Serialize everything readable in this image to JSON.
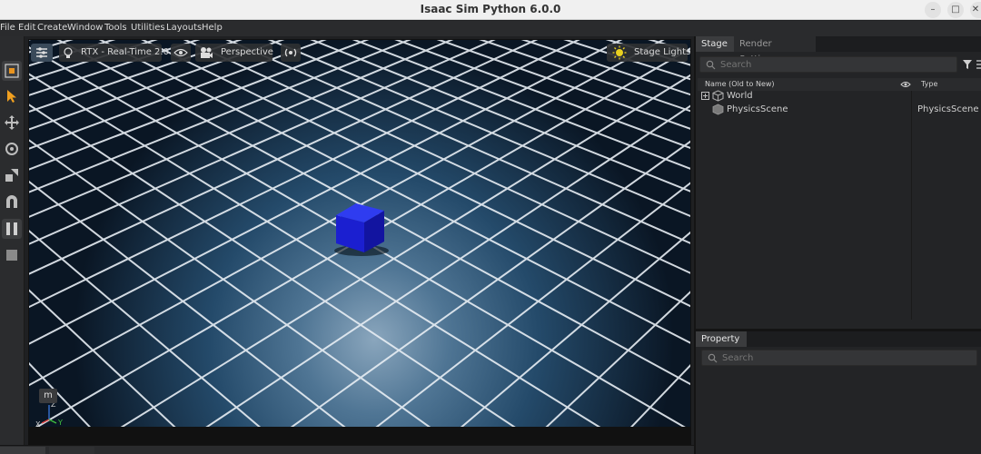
{
  "window": {
    "title": "Isaac Sim Python 6.0.0",
    "minimize_icon": "minimize-icon",
    "maximize_icon": "maximize-icon",
    "close_icon": "close-icon"
  },
  "menubar": {
    "items": [
      {
        "label": "File"
      },
      {
        "label": "Edit"
      },
      {
        "label": "Create"
      },
      {
        "label": "Window"
      },
      {
        "label": "Tools"
      },
      {
        "label": "Utilities"
      },
      {
        "label": "Layouts"
      },
      {
        "label": "Help"
      }
    ]
  },
  "left_toolbar": {
    "tools": [
      {
        "name": "select-mode-icon"
      },
      {
        "name": "select-arrow-icon"
      },
      {
        "name": "move-icon"
      },
      {
        "name": "rotate-icon"
      },
      {
        "name": "scale-icon"
      },
      {
        "name": "snap-magnet-icon"
      },
      {
        "name": "pause-icon"
      },
      {
        "name": "stop-icon"
      }
    ]
  },
  "viewport": {
    "settings_icon": "viewport-settings-icon",
    "renderer_label": "RTX - Real-Time 2.0",
    "camera_label": "Perspective",
    "lights_label": "Stage Lights",
    "mode_key": "m",
    "axis_labels": {
      "z": "Z",
      "x": "X",
      "y": "Y"
    },
    "object_color": "#1b1fd0",
    "grid_color": "#e8eef4"
  },
  "stage_panel": {
    "tabs": [
      {
        "label": "Stage",
        "active": true
      },
      {
        "label": "Render Settings",
        "active": false
      }
    ],
    "search_placeholder": "Search",
    "columns": {
      "name": "Name (Old to New)",
      "type": "Type"
    },
    "tree": [
      {
        "name": "World",
        "type": "",
        "expandable": true
      },
      {
        "name": "PhysicsScene",
        "type": "PhysicsScene",
        "expandable": false
      }
    ]
  },
  "property_panel": {
    "tab_label": "Property",
    "search_placeholder": "Search"
  },
  "colors": {
    "menubar_bg": "#2a2b2d",
    "panel_bg": "#232426",
    "viewport_bg": "#0a1624",
    "active_tool": "#f0a020"
  }
}
